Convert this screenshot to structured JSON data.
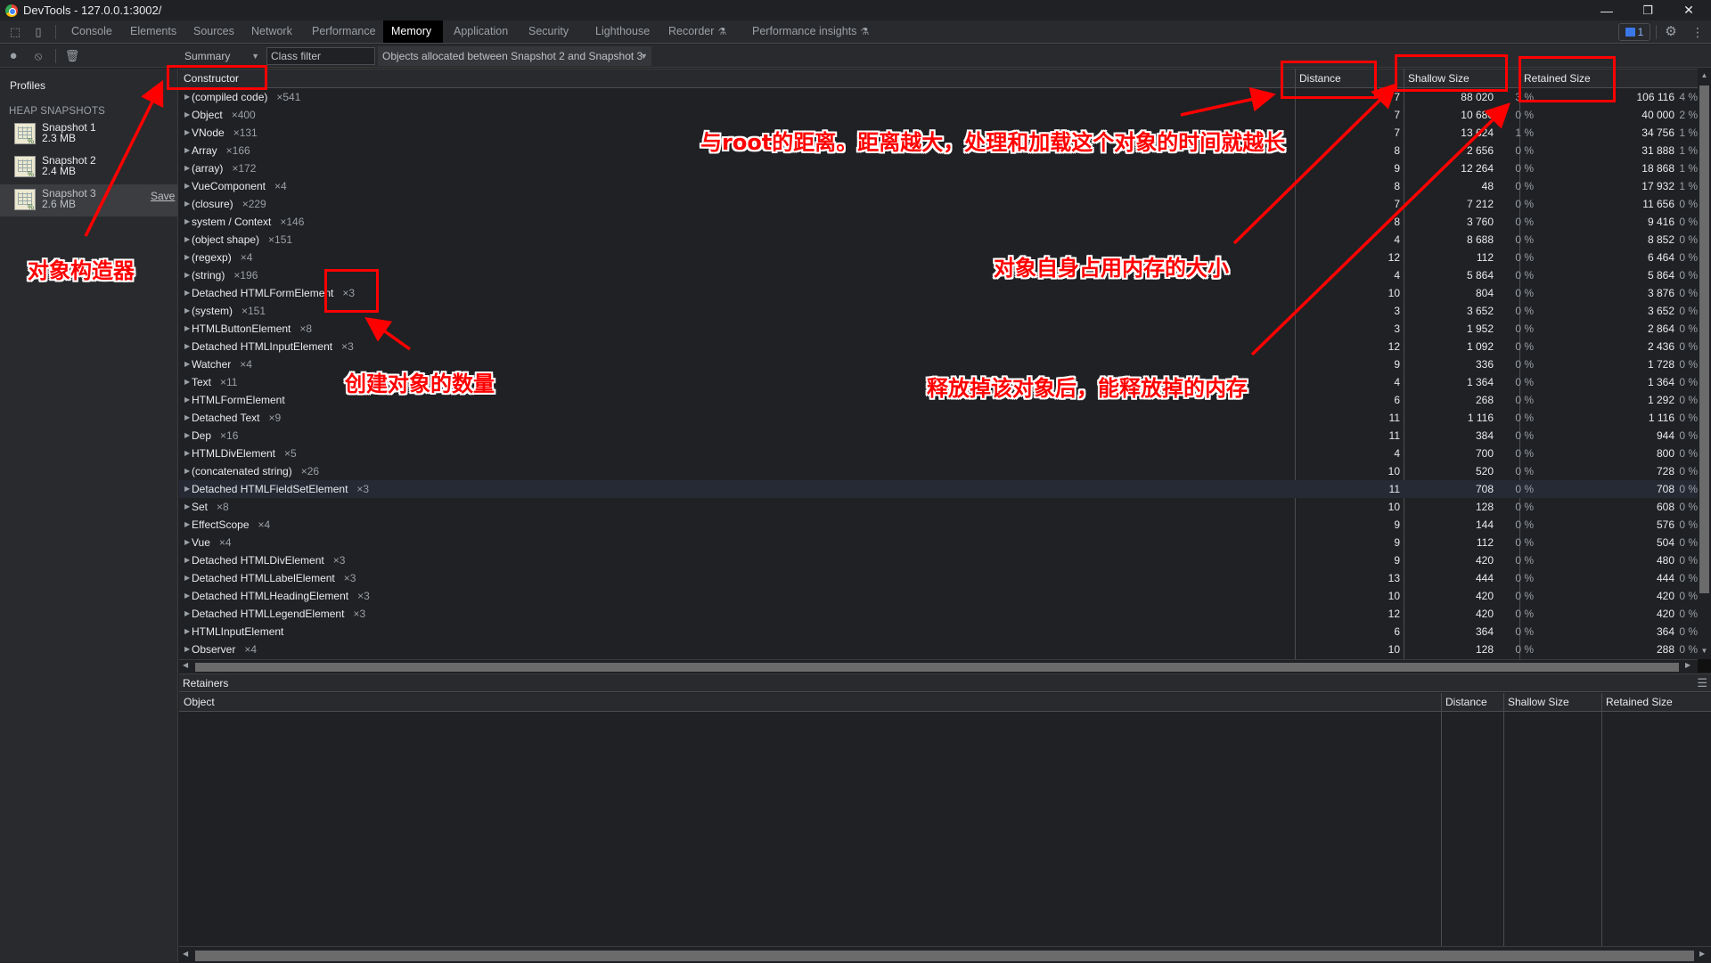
{
  "window": {
    "title": "DevTools - 127.0.0.1:3002/",
    "minimize_glyph": "—",
    "restore_glyph": "❐",
    "close_glyph": "✕"
  },
  "tabs": [
    {
      "label": "Console"
    },
    {
      "label": "Elements"
    },
    {
      "label": "Sources"
    },
    {
      "label": "Network"
    },
    {
      "label": "Performance"
    },
    {
      "label": "Memory",
      "active": true
    },
    {
      "label": "Application"
    },
    {
      "label": "Security"
    },
    {
      "label": "Lighthouse"
    },
    {
      "label": "Recorder",
      "experimental": true
    },
    {
      "label": "Performance insights",
      "experimental": true
    }
  ],
  "tabbar_right": {
    "issues_count": "1",
    "settings_icon": "gear-icon",
    "more_icon": "kebab-menu-icon"
  },
  "toolbar": {
    "view": "Summary",
    "class_filter_placeholder": "Class filter",
    "range": "Objects allocated between Snapshot 2 and Snapshot 3"
  },
  "sidebar": {
    "profiles_label": "Profiles",
    "section_label": "HEAP SNAPSHOTS",
    "snapshots": [
      {
        "name": "Snapshot 1",
        "size": "2.3 MB"
      },
      {
        "name": "Snapshot 2",
        "size": "2.4 MB"
      },
      {
        "name": "Snapshot 3",
        "size": "2.6 MB",
        "selected": true,
        "action": "Save"
      }
    ]
  },
  "grid": {
    "columns": {
      "constructor": "Constructor",
      "distance": "Distance",
      "shallow": "Shallow Size",
      "retained": "Retained Size"
    },
    "rows": [
      {
        "name": "(compiled code)",
        "count": "×541",
        "distance": "7",
        "shallow": "88 020",
        "shallow_pct": "3 %",
        "retained": "106 116",
        "retained_pct": "4 %"
      },
      {
        "name": "Object",
        "count": "×400",
        "distance": "7",
        "shallow": "10 680",
        "shallow_pct": "0 %",
        "retained": "40 000",
        "retained_pct": "2 %"
      },
      {
        "name": "VNode",
        "count": "×131",
        "distance": "7",
        "shallow": "13 624",
        "shallow_pct": "1 %",
        "retained": "34 756",
        "retained_pct": "1 %"
      },
      {
        "name": "Array",
        "count": "×166",
        "distance": "8",
        "shallow": "2 656",
        "shallow_pct": "0 %",
        "retained": "31 888",
        "retained_pct": "1 %"
      },
      {
        "name": "(array)",
        "count": "×172",
        "distance": "9",
        "shallow": "12 264",
        "shallow_pct": "0 %",
        "retained": "18 868",
        "retained_pct": "1 %"
      },
      {
        "name": "VueComponent",
        "count": "×4",
        "distance": "8",
        "shallow": "48",
        "shallow_pct": "0 %",
        "retained": "17 932",
        "retained_pct": "1 %"
      },
      {
        "name": "(closure)",
        "count": "×229",
        "distance": "7",
        "shallow": "7 212",
        "shallow_pct": "0 %",
        "retained": "11 656",
        "retained_pct": "0 %"
      },
      {
        "name": "system / Context",
        "count": "×146",
        "distance": "8",
        "shallow": "3 760",
        "shallow_pct": "0 %",
        "retained": "9 416",
        "retained_pct": "0 %"
      },
      {
        "name": "(object shape)",
        "count": "×151",
        "distance": "4",
        "shallow": "8 688",
        "shallow_pct": "0 %",
        "retained": "8 852",
        "retained_pct": "0 %"
      },
      {
        "name": "(regexp)",
        "count": "×4",
        "distance": "12",
        "shallow": "112",
        "shallow_pct": "0 %",
        "retained": "6 464",
        "retained_pct": "0 %"
      },
      {
        "name": "(string)",
        "count": "×196",
        "distance": "4",
        "shallow": "5 864",
        "shallow_pct": "0 %",
        "retained": "5 864",
        "retained_pct": "0 %"
      },
      {
        "name": "Detached HTMLFormElement",
        "count": "×3",
        "distance": "10",
        "shallow": "804",
        "shallow_pct": "0 %",
        "retained": "3 876",
        "retained_pct": "0 %"
      },
      {
        "name": "(system)",
        "count": "×151",
        "distance": "3",
        "shallow": "3 652",
        "shallow_pct": "0 %",
        "retained": "3 652",
        "retained_pct": "0 %"
      },
      {
        "name": "HTMLButtonElement",
        "count": "×8",
        "distance": "3",
        "shallow": "1 952",
        "shallow_pct": "0 %",
        "retained": "2 864",
        "retained_pct": "0 %"
      },
      {
        "name": "Detached HTMLInputElement",
        "count": "×3",
        "distance": "12",
        "shallow": "1 092",
        "shallow_pct": "0 %",
        "retained": "2 436",
        "retained_pct": "0 %"
      },
      {
        "name": "Watcher",
        "count": "×4",
        "distance": "9",
        "shallow": "336",
        "shallow_pct": "0 %",
        "retained": "1 728",
        "retained_pct": "0 %"
      },
      {
        "name": "Text",
        "count": "×11",
        "distance": "4",
        "shallow": "1 364",
        "shallow_pct": "0 %",
        "retained": "1 364",
        "retained_pct": "0 %"
      },
      {
        "name": "HTMLFormElement",
        "count": "",
        "distance": "6",
        "shallow": "268",
        "shallow_pct": "0 %",
        "retained": "1 292",
        "retained_pct": "0 %"
      },
      {
        "name": "Detached Text",
        "count": "×9",
        "distance": "11",
        "shallow": "1 116",
        "shallow_pct": "0 %",
        "retained": "1 116",
        "retained_pct": "0 %"
      },
      {
        "name": "Dep",
        "count": "×16",
        "distance": "11",
        "shallow": "384",
        "shallow_pct": "0 %",
        "retained": "944",
        "retained_pct": "0 %"
      },
      {
        "name": "HTMLDivElement",
        "count": "×5",
        "distance": "4",
        "shallow": "700",
        "shallow_pct": "0 %",
        "retained": "800",
        "retained_pct": "0 %"
      },
      {
        "name": "(concatenated string)",
        "count": "×26",
        "distance": "10",
        "shallow": "520",
        "shallow_pct": "0 %",
        "retained": "728",
        "retained_pct": "0 %"
      },
      {
        "name": "Detached HTMLFieldSetElement",
        "count": "×3",
        "distance": "11",
        "shallow": "708",
        "shallow_pct": "0 %",
        "retained": "708",
        "retained_pct": "0 %",
        "highlight": true
      },
      {
        "name": "Set",
        "count": "×8",
        "distance": "10",
        "shallow": "128",
        "shallow_pct": "0 %",
        "retained": "608",
        "retained_pct": "0 %"
      },
      {
        "name": "EffectScope",
        "count": "×4",
        "distance": "9",
        "shallow": "144",
        "shallow_pct": "0 %",
        "retained": "576",
        "retained_pct": "0 %"
      },
      {
        "name": "Vue",
        "count": "×4",
        "distance": "9",
        "shallow": "112",
        "shallow_pct": "0 %",
        "retained": "504",
        "retained_pct": "0 %"
      },
      {
        "name": "Detached HTMLDivElement",
        "count": "×3",
        "distance": "9",
        "shallow": "420",
        "shallow_pct": "0 %",
        "retained": "480",
        "retained_pct": "0 %"
      },
      {
        "name": "Detached HTMLLabelElement",
        "count": "×3",
        "distance": "13",
        "shallow": "444",
        "shallow_pct": "0 %",
        "retained": "444",
        "retained_pct": "0 %"
      },
      {
        "name": "Detached HTMLHeadingElement",
        "count": "×3",
        "distance": "10",
        "shallow": "420",
        "shallow_pct": "0 %",
        "retained": "420",
        "retained_pct": "0 %"
      },
      {
        "name": "Detached HTMLLegendElement",
        "count": "×3",
        "distance": "12",
        "shallow": "420",
        "shallow_pct": "0 %",
        "retained": "420",
        "retained_pct": "0 %"
      },
      {
        "name": "HTMLInputElement",
        "count": "",
        "distance": "6",
        "shallow": "364",
        "shallow_pct": "0 %",
        "retained": "364",
        "retained_pct": "0 %"
      },
      {
        "name": "Observer",
        "count": "×4",
        "distance": "10",
        "shallow": "128",
        "shallow_pct": "0 %",
        "retained": "288",
        "retained_pct": "0 %"
      }
    ]
  },
  "retainers": {
    "title": "Retainers",
    "columns": {
      "object": "Object",
      "distance": "Distance",
      "shallow": "Shallow Size",
      "retained": "Retained Size"
    }
  },
  "annotations": {
    "constructor_note": "对象构造器",
    "count_note": "创建对象的数量",
    "distance_note": "与root的距离。距离越大，处理和加载这个对象的时间就越长",
    "shallow_note": "对象自身占用内存的大小",
    "retained_note": "释放掉该对象后，能释放掉的内存",
    "highlight_color": "#ff0000"
  }
}
